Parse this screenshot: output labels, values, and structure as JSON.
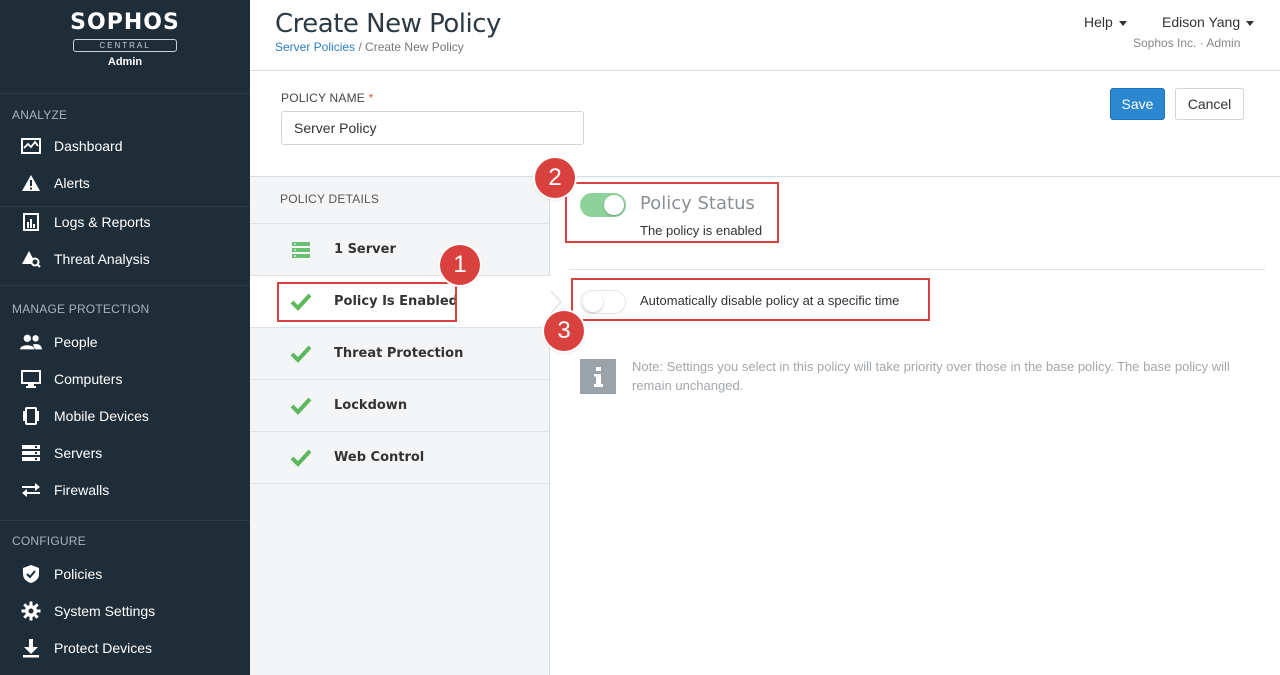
{
  "brand": {
    "name": "SOPHOS",
    "product": "CENTRAL",
    "role": "Admin"
  },
  "sidebar": {
    "sections": [
      {
        "heading": "ANALYZE",
        "items": [
          {
            "label": "Dashboard",
            "icon": "dashboard-icon"
          },
          {
            "label": "Alerts",
            "icon": "alert-icon"
          },
          {
            "label": "Logs & Reports",
            "icon": "reports-icon"
          },
          {
            "label": "Threat Analysis",
            "icon": "threat-analysis-icon"
          }
        ]
      },
      {
        "heading": "MANAGE PROTECTION",
        "items": [
          {
            "label": "People",
            "icon": "people-icon"
          },
          {
            "label": "Computers",
            "icon": "computer-icon"
          },
          {
            "label": "Mobile Devices",
            "icon": "mobile-icon"
          },
          {
            "label": "Servers",
            "icon": "server-icon"
          },
          {
            "label": "Firewalls",
            "icon": "firewall-icon"
          }
        ]
      },
      {
        "heading": "CONFIGURE",
        "items": [
          {
            "label": "Policies",
            "icon": "shield-icon"
          },
          {
            "label": "System Settings",
            "icon": "gear-icon"
          },
          {
            "label": "Protect Devices",
            "icon": "download-icon"
          }
        ]
      }
    ]
  },
  "header": {
    "title": "Create New Policy",
    "breadcrumb_link": "Server Policies",
    "breadcrumb_sep": " / ",
    "breadcrumb_current": "Create New Policy",
    "help": "Help",
    "user": "Edison Yang",
    "org": "Sophos Inc. · Admin"
  },
  "policy_name": {
    "label": "POLICY NAME",
    "required_mark": "*",
    "value": "Server Policy"
  },
  "actions": {
    "save": "Save",
    "cancel": "Cancel"
  },
  "details": {
    "heading": "POLICY DETAILS",
    "items": [
      {
        "label": "1 Server",
        "icon": "server-stack-icon"
      },
      {
        "label": "Policy Is Enabled",
        "icon": "check-icon"
      },
      {
        "label": "Threat Protection",
        "icon": "check-icon"
      },
      {
        "label": "Lockdown",
        "icon": "check-icon"
      },
      {
        "label": "Web Control",
        "icon": "check-icon"
      }
    ]
  },
  "status": {
    "title": "Policy Status",
    "subtitle": "The policy is enabled",
    "enabled": true
  },
  "auto_disable": {
    "label": "Automatically disable policy at a specific time",
    "enabled": false
  },
  "note": {
    "text": "Note: Settings you select in this policy will take priority over those in the base policy. The base policy will remain unchanged."
  },
  "callouts": [
    "1",
    "2",
    "3"
  ],
  "colors": {
    "sidebar_bg": "#1f2d38",
    "accent": "#2a87d0",
    "toggle_on": "#8fd19a",
    "check": "#5cb85c",
    "callout": "#d9413f"
  }
}
